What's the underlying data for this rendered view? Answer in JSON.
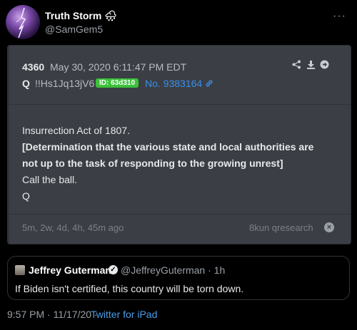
{
  "tweet": {
    "display_name": "Truth Storm",
    "name_emoji": "🌧",
    "handle": "@SamGem5",
    "more_glyph": "···"
  },
  "post": {
    "number": "4360",
    "date": "May 30, 2020 6:11:47 PM EDT",
    "author": "Q",
    "tripcode": "!!Hs1Jq13jV6",
    "id_badge": "ID: 63d310",
    "post_no": "No. 9383164",
    "line1": "Insurrection Act of 1807.",
    "line2": "[Determination that the various state and local authorities are",
    "line3": "not up to the task of responding to the growing unrest]",
    "line4": "Call the ball.",
    "line5": "Q",
    "age": "5m, 2w, 4d, 4h, 45m ago",
    "board": "8kun qresearch",
    "colors": {
      "badge": "#3cc13b",
      "link": "#3b8ee8",
      "card": "#3b3f45"
    }
  },
  "quoted": {
    "name": "Jeffrey Guterman",
    "handle_time": "@JeffreyGuterman · 1h",
    "text": "If Biden isn't certified, this country will be torn down."
  },
  "meta": {
    "timestamp": "9:57 PM · 11/17/20 · ",
    "source": "Twitter for iPad"
  }
}
